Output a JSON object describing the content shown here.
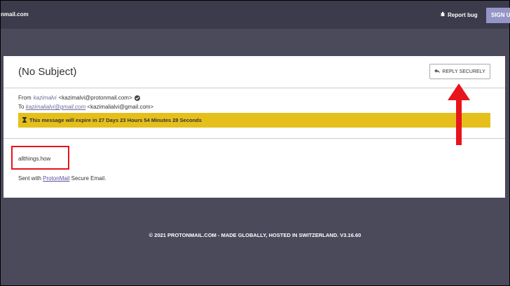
{
  "topbar": {
    "brand_partial": "nmail.com",
    "report_bug": "Report bug",
    "sign_up_partial": "SIGN U"
  },
  "message": {
    "subject": "(No Subject)",
    "reply_button": "REPLY SECURELY",
    "from_label": "From",
    "from_name": "kazimalvi",
    "from_email": "<kazimalvi@protonmail.com>",
    "to_label": "To",
    "to_name": "kazimalialvi@gmail.com",
    "to_email": "<kazimalialvi@gmail.com>",
    "expire_text": "This message will expire in 27 Days 23 Hours 54 Minutes 28 Seconds",
    "body": "allthings.how",
    "signature_prefix": "Sent with ",
    "signature_link": "ProtonMail",
    "signature_suffix": " Secure Email."
  },
  "footer": {
    "text": "© 2021 PROTONMAIL.COM - MADE GLOBALLY, HOSTED IN SWITZERLAND. V3.16.60"
  },
  "colors": {
    "page_bg": "#4a4a5b",
    "topbar_bg": "#3b3b4b",
    "expire_banner": "#e5c01c",
    "annotation": "#e8141c",
    "signup_button": "#9595c7"
  }
}
